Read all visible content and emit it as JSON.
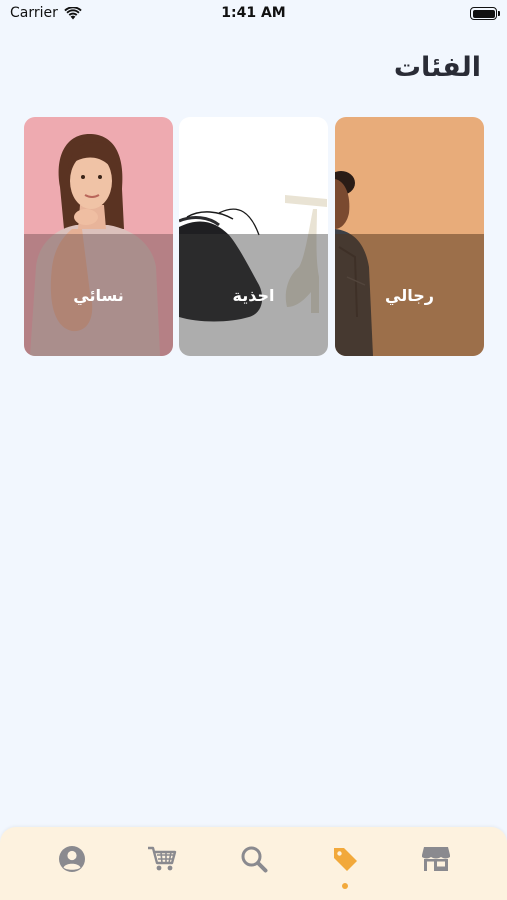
{
  "status_bar": {
    "carrier": "Carrier",
    "time": "1:41 AM",
    "icons": [
      "wifi-icon",
      "battery-icon"
    ]
  },
  "page": {
    "title": "الفئات"
  },
  "categories": [
    {
      "label": "نسائي",
      "image": "woman-photo"
    },
    {
      "label": "احذية",
      "image": "shoes-photo"
    },
    {
      "label": "رجالي",
      "image": "man-photo"
    }
  ],
  "tab_bar": {
    "items": [
      {
        "icon": "profile-icon",
        "active": false
      },
      {
        "icon": "cart-icon",
        "active": false
      },
      {
        "icon": "search-icon",
        "active": false
      },
      {
        "icon": "tag-icon",
        "active": true
      },
      {
        "icon": "store-icon",
        "active": false
      }
    ],
    "colors": {
      "inactive": "#8a8a8f",
      "active": "#f2a93b",
      "background": "#fdf2df"
    }
  }
}
